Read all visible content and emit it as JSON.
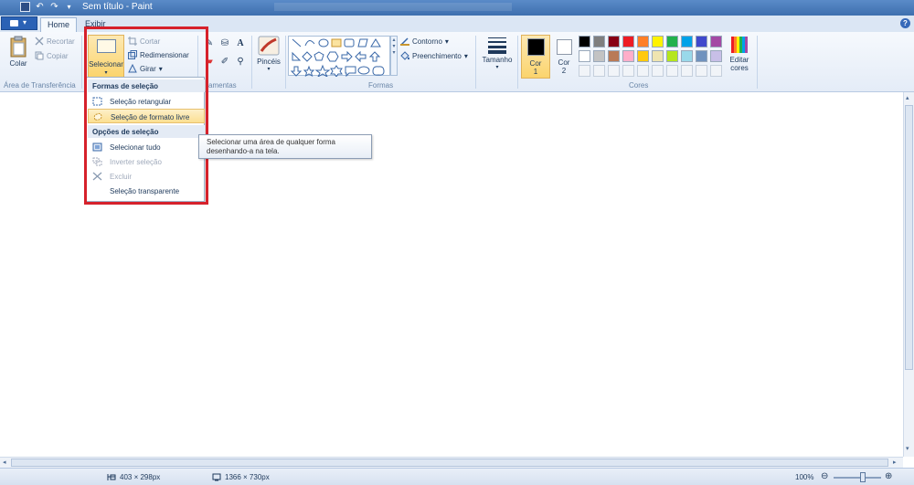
{
  "window": {
    "title": "Sem título - Paint"
  },
  "tabs": [
    {
      "label": "Home",
      "active": true
    },
    {
      "label": "Exibir",
      "active": false
    }
  ],
  "clipboard": {
    "paste_label": "Colar",
    "cut_label": "Recortar",
    "copy_label": "Copiar",
    "group_label": "Área de Transferência"
  },
  "image": {
    "select_label": "Selecionar",
    "crop_label": "Cortar",
    "resize_label": "Redimensionar",
    "rotate_label": "Girar"
  },
  "tools": {
    "group_label": "Ferramentas",
    "group_label_visible": "amentas"
  },
  "brushes": {
    "label": "Pincéis"
  },
  "shapes": {
    "outline_label": "Contorno",
    "fill_label": "Preenchimento",
    "group_label": "Formas"
  },
  "size": {
    "label": "Tamanho"
  },
  "colors": {
    "color1_label": "Cor 1",
    "color1_line1": "Cor",
    "color1_line2": "1",
    "color2_line1": "Cor",
    "color2_line2": "2",
    "edit_line1": "Editar",
    "edit_line2": "cores",
    "group_label": "Cores",
    "color1_value": "#000000",
    "color2_value": "#ffffff",
    "palette_row1": [
      "#000000",
      "#7f7f7f",
      "#880015",
      "#ed1c24",
      "#ff7f27",
      "#fff200",
      "#22b14c",
      "#00a2e8",
      "#3f48cc",
      "#a349a4"
    ],
    "palette_row2": [
      "#ffffff",
      "#c3c3c3",
      "#b97a57",
      "#ffaec9",
      "#ffc90e",
      "#efe4b0",
      "#b5e61d",
      "#99d9ea",
      "#7092be",
      "#c8bfe7"
    ]
  },
  "select_menu": {
    "section1_title": "Formas de seleção",
    "rect_select": "Seleção retangular",
    "free_select": "Seleção de formato livre",
    "section2_title": "Opções de seleção",
    "select_all": "Selecionar tudo",
    "invert_select": "Inverter seleção",
    "delete": "Excluir",
    "transparent": "Seleção transparente"
  },
  "tooltip": {
    "line1": "Selecionar uma área de qualquer forma",
    "line2": "desenhando-a na tela."
  },
  "status": {
    "cursor_pos": "403 × 298px",
    "canvas_size": "1366 × 730px",
    "zoom": "100%"
  },
  "accent_color": "#d6212b"
}
